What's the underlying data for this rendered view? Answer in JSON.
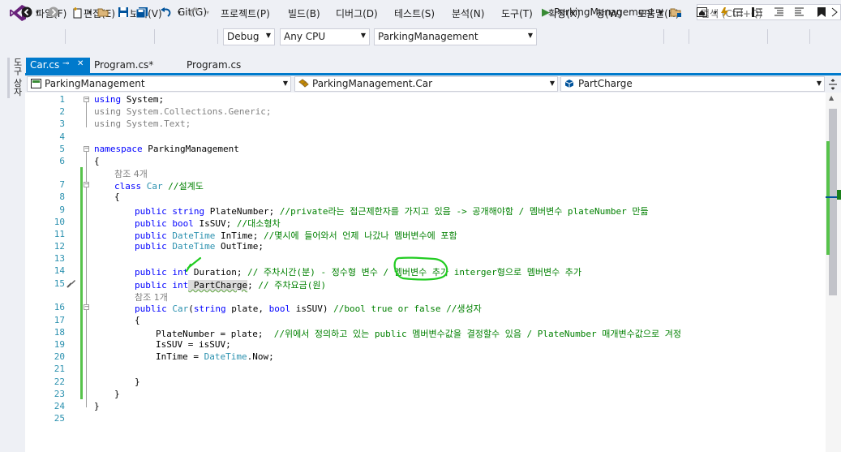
{
  "menu": {
    "items": [
      "파일(F)",
      "편집(E)",
      "보기(V)",
      "Git(G)",
      "프로젝트(P)",
      "빌드(B)",
      "디버그(D)",
      "테스트(S)",
      "분석(N)",
      "도구(T)",
      "확장(X)",
      "창(W)",
      "도움말(H)"
    ],
    "search_placeholder": "검색 (Ctrl+Q)"
  },
  "toolbar": {
    "config": "Debug",
    "platform": "Any CPU",
    "startup_project": "ParkingManagement",
    "run_label": "ParkingManagement"
  },
  "sidebar": {
    "vertical_tab": "도구 상자"
  },
  "tabs": [
    {
      "label": "Car.cs",
      "active": true,
      "pin": "⊸",
      "close": "✕"
    },
    {
      "label": "Program.cs*",
      "active": false
    },
    {
      "label": "Program.cs",
      "active": false
    }
  ],
  "nav": {
    "project": "ParkingManagement",
    "class": "ParkingManagement.Car",
    "member": "PartCharge"
  },
  "refs": {
    "class_refs": "참조 4개",
    "ctor_refs": "참조 1개"
  },
  "code": {
    "l1": [
      "using",
      " System;"
    ],
    "l2": [
      "using",
      " System.Collections.Generic;"
    ],
    "l3": [
      "using",
      " System.Text;"
    ],
    "l5": [
      "namespace",
      " ParkingManagement"
    ],
    "l6": "{",
    "l7": [
      "class",
      "Car",
      "//설계도"
    ],
    "l8": "{",
    "l9": [
      "public",
      "string",
      " PlateNumber; ",
      "//private라는 접근제한자를 가지고 있음 -> 공개해야함 / 멤버변수 plateNumber 만듦"
    ],
    "l10": [
      "public",
      "bool",
      " IsSUV; ",
      "//대소형차"
    ],
    "l11": [
      "public",
      "DateTime",
      " InTime; ",
      "//몇시에 들어와서 언제 나갔나 멤버변수에 포함"
    ],
    "l12": [
      "public",
      "DateTime",
      " OutTime;"
    ],
    "l14": [
      "public",
      "int",
      " Duration; ",
      "// 주차시간(분) - 정수형 변수 / 멤버변수 추가 interger형으로 멤버변수 추가"
    ],
    "l15": [
      "public",
      "int",
      " PartCharge",
      "; ",
      "// 주차요금(원)"
    ],
    "l16": [
      "public",
      "Car",
      "(",
      "string",
      " plate, ",
      "bool",
      " isSUV) ",
      "//bool true or false //생성자"
    ],
    "l17": "{",
    "l18": [
      "PlateNumber = plate;  ",
      "//위에서 정의하고 있는 public 멤버변수값을 결정할수 있음 / PlateNumber 매개변수값으로 겨정"
    ],
    "l19": "IsSUV = isSUV;",
    "l20": [
      "InTime = ",
      "DateTime",
      ".Now;"
    ],
    "l22": "}",
    "l23": "}",
    "l24": "}"
  },
  "line_numbers": [
    "1",
    "2",
    "3",
    "4",
    "5",
    "6",
    "7",
    "8",
    "9",
    "10",
    "11",
    "12",
    "13",
    "14",
    "15",
    "16",
    "17",
    "18",
    "19",
    "20",
    "21",
    "22",
    "23",
    "24",
    "25"
  ],
  "colors": {
    "accent": "#007acc",
    "keyword": "#0000ff",
    "type": "#2b91af",
    "comment": "#008000",
    "change_bar": "#57c34b",
    "annotation": "#22cc22"
  }
}
